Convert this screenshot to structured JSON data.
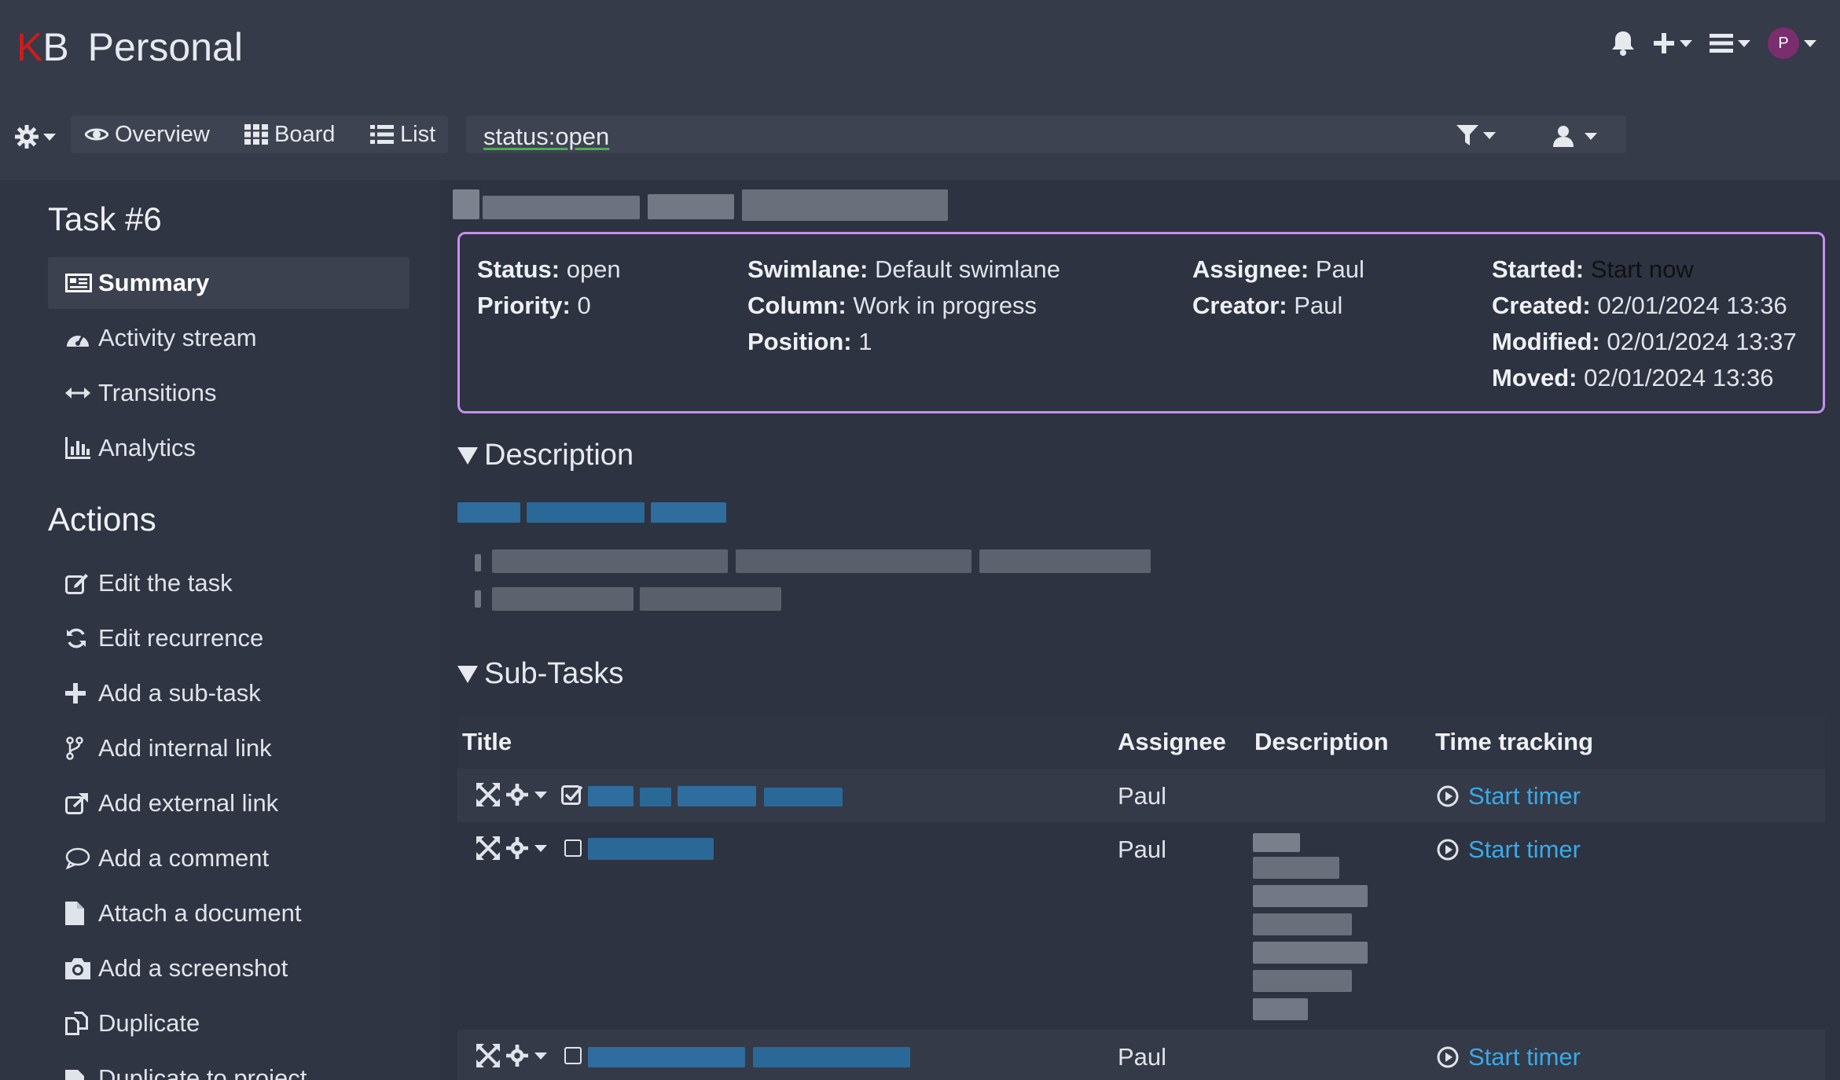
{
  "header": {
    "logo_k": "K",
    "logo_b": "B",
    "project_name": "Personal",
    "avatar_letter": "P",
    "brand_color": "#d11b1b"
  },
  "nav": {
    "overview": "Overview",
    "board": "Board",
    "list": "List",
    "filter_value": "status:open"
  },
  "sidebar": {
    "task_heading": "Task #6",
    "task_items": [
      {
        "label": "Summary",
        "icon": "newspaper-icon"
      },
      {
        "label": "Activity stream",
        "icon": "dashboard-icon"
      },
      {
        "label": "Transitions",
        "icon": "arrows-h-icon"
      },
      {
        "label": "Analytics",
        "icon": "bar-chart-icon"
      }
    ],
    "actions_heading": "Actions",
    "actions": [
      {
        "label": "Edit the task",
        "icon": "edit-icon"
      },
      {
        "label": "Edit recurrence",
        "icon": "refresh-icon"
      },
      {
        "label": "Add a sub-task",
        "icon": "plus-icon"
      },
      {
        "label": "Add internal link",
        "icon": "code-fork-icon"
      },
      {
        "label": "Add external link",
        "icon": "external-link-icon"
      },
      {
        "label": "Add a comment",
        "icon": "comment-icon"
      },
      {
        "label": "Attach a document",
        "icon": "file-icon"
      },
      {
        "label": "Add a screenshot",
        "icon": "camera-icon"
      },
      {
        "label": "Duplicate",
        "icon": "files-icon"
      },
      {
        "label": "Duplicate to project",
        "icon": "clone-icon"
      }
    ]
  },
  "summary": {
    "status_label": "Status:",
    "status_value": "open",
    "priority_label": "Priority:",
    "priority_value": "0",
    "swimlane_label": "Swimlane:",
    "swimlane_value": "Default swimlane",
    "column_label": "Column:",
    "column_value": "Work in progress",
    "position_label": "Position:",
    "position_value": "1",
    "assignee_label": "Assignee:",
    "assignee_value": "Paul",
    "creator_label": "Creator:",
    "creator_value": "Paul",
    "started_label": "Started:",
    "started_value": "Start now",
    "created_label": "Created:",
    "created_value": "02/01/2024 13:36",
    "modified_label": "Modified:",
    "modified_value": "02/01/2024 13:37",
    "moved_label": "Moved:",
    "moved_value": "02/01/2024 13:36",
    "border_color": "#c68ef0"
  },
  "description": {
    "heading": "Description"
  },
  "subtasks": {
    "heading": "Sub-Tasks",
    "columns": [
      "Title",
      "Assignee",
      "Description",
      "Time tracking"
    ],
    "rows": [
      {
        "assignee": "Paul",
        "timer": "Start timer",
        "done": true
      },
      {
        "assignee": "Paul",
        "timer": "Start timer",
        "done": false
      },
      {
        "assignee": "Paul",
        "timer": "Start timer",
        "done": false
      }
    ],
    "link_color": "#3aa9e8"
  }
}
